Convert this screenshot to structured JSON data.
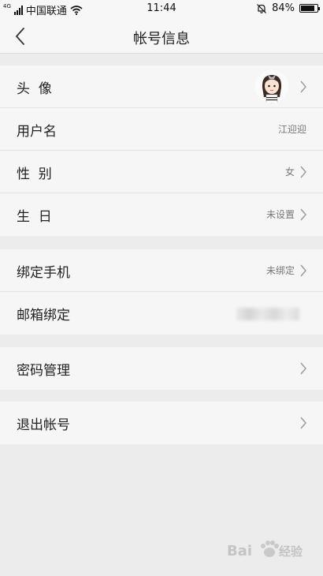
{
  "status_bar": {
    "network_tag": "4G",
    "carrier": "中国联通",
    "time": "11:44",
    "battery_percent": "84%",
    "battery_level": 0.84
  },
  "nav": {
    "title": "帐号信息"
  },
  "groups": [
    {
      "rows": [
        {
          "label": "头  像",
          "value": ""
        },
        {
          "label": "用户名",
          "value": "江迎迎"
        },
        {
          "label": "性  别",
          "value": "女"
        },
        {
          "label": "生  日",
          "value": "未设置"
        }
      ]
    },
    {
      "rows": [
        {
          "label": "绑定手机",
          "value": "未绑定"
        },
        {
          "label": "邮箱绑定",
          "value": ""
        }
      ]
    },
    {
      "rows": [
        {
          "label": "密码管理",
          "value": ""
        }
      ]
    },
    {
      "rows": [
        {
          "label": "退出帐号",
          "value": ""
        }
      ]
    }
  ],
  "watermark": {
    "text": "Bai 经验"
  },
  "colors": {
    "background": "#ececec",
    "row_bg": "#f6f6f6",
    "text": "#222222",
    "secondary_text": "#777777"
  }
}
